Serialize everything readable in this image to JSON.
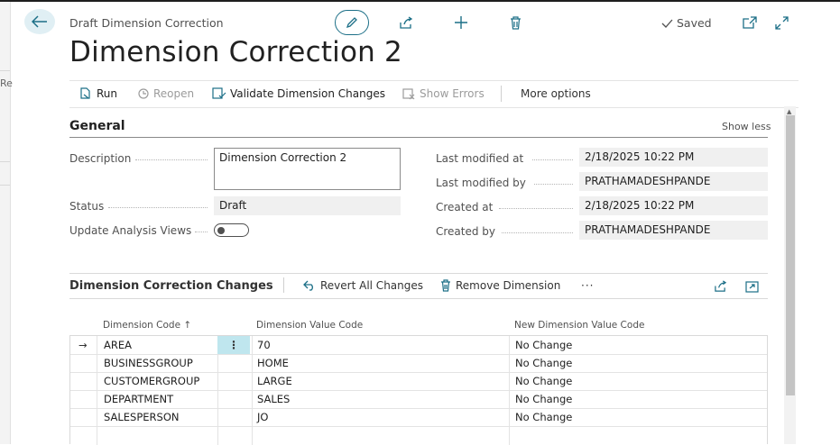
{
  "header": {
    "breadcrumb": "Draft Dimension Correction",
    "title": "Dimension Correction 2",
    "saved_label": "Saved",
    "left_fragment": "Re"
  },
  "actions": {
    "run": "Run",
    "reopen": "Reopen",
    "validate": "Validate Dimension Changes",
    "show_errors": "Show Errors",
    "more_options": "More options"
  },
  "general": {
    "title": "General",
    "show_less": "Show less",
    "description_label": "Description",
    "description_value": "Dimension Correction 2",
    "status_label": "Status",
    "status_value": "Draft",
    "update_views_label": "Update Analysis Views",
    "update_views_value": false,
    "last_modified_at_label": "Last modified at",
    "last_modified_at_value": "2/18/2025 10:22 PM",
    "last_modified_by_label": "Last modified by",
    "last_modified_by_value": "PRATHAMADESHPANDE",
    "created_at_label": "Created at",
    "created_at_value": "2/18/2025 10:22 PM",
    "created_by_label": "Created by",
    "created_by_value": "PRATHAMADESHPANDE"
  },
  "changes": {
    "title": "Dimension Correction Changes",
    "revert_all": "Revert All Changes",
    "remove_dimension": "Remove Dimension",
    "more": "···",
    "columns": [
      "Dimension Code ↑",
      "Dimension Value Code",
      "New Dimension Value Code"
    ],
    "rows": [
      {
        "code": "AREA",
        "value": "70",
        "new_value": "No Change"
      },
      {
        "code": "BUSINESSGROUP",
        "value": "HOME",
        "new_value": "No Change"
      },
      {
        "code": "CUSTOMERGROUP",
        "value": "LARGE",
        "new_value": "No Change"
      },
      {
        "code": "DEPARTMENT",
        "value": "SALES",
        "new_value": "No Change"
      },
      {
        "code": "SALESPERSON",
        "value": "JO",
        "new_value": "No Change"
      }
    ],
    "row_menu_glyph": "⋮",
    "current_row_glyph": "→"
  },
  "colors": {
    "accent": "#1c6f87",
    "selected_cell": "#bfe6ee",
    "field_bg": "#f0f0f0"
  }
}
